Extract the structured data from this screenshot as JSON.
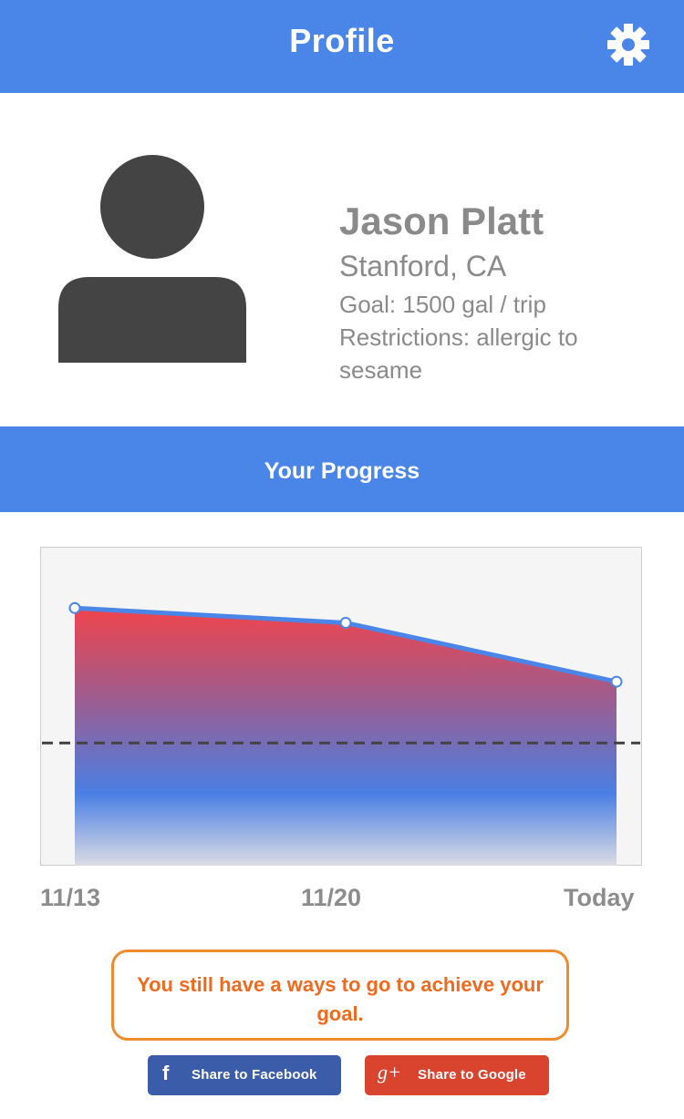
{
  "header": {
    "title": "Profile",
    "settings_icon": "gear-icon",
    "background_color": "#4A86E8"
  },
  "profile": {
    "avatar_icon": "user-avatar-icon",
    "name": "Jason Platt",
    "location": "Stanford, CA",
    "goal": "Goal: 1500 gal / trip",
    "restrictions": "Restrictions: allergic to sesame"
  },
  "progress_header": {
    "label": "Your Progress"
  },
  "chart_data": {
    "type": "area",
    "categories": [
      "11/13",
      "11/20",
      "Today"
    ],
    "series": [
      {
        "values": [
          2050,
          1990,
          1750
        ]
      }
    ],
    "goal_line": 1500,
    "ylim": [
      1000,
      2300
    ],
    "grid": false,
    "colors": {
      "line": "#4A86E8",
      "fill_top": "#F0444C",
      "fill_mid": "#4A7FE4",
      "goal_line": "#444444"
    }
  },
  "message": {
    "text": "You still have a ways to go to achieve your goal.",
    "border_color": "#F08A2E",
    "text_color": "#F06A1E"
  },
  "share": {
    "facebook": {
      "icon": "facebook-icon",
      "glyph": "f",
      "label": "Share to Facebook",
      "color": "#3B5CA8"
    },
    "google": {
      "icon": "google-plus-icon",
      "glyph": "g+",
      "label": "Share to Google",
      "color": "#D9442F"
    }
  }
}
